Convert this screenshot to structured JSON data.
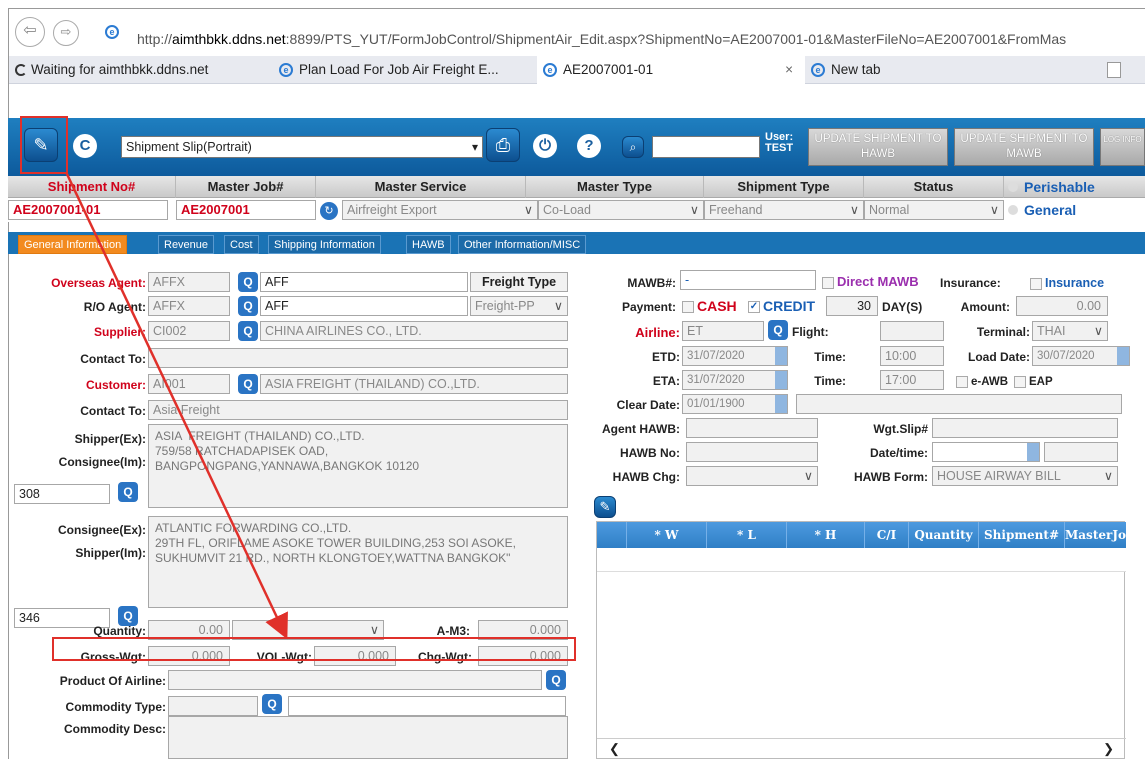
{
  "browser": {
    "url_prefix": "http://",
    "url_host": "aimthbkk.ddns.net",
    "url_rest": ":8899/PTS_YUT/FormJobControl/ShipmentAir_Edit.aspx?ShipmentNo=AE2007001-01&MasterFileNo=AE2007001&FromMas",
    "tabs": [
      {
        "label": "Waiting for aimthbkk.ddns.net"
      },
      {
        "label": "Plan Load For Job Air Freight E..."
      },
      {
        "label": "AE2007001-01"
      },
      {
        "label": "New tab"
      }
    ]
  },
  "toolbar": {
    "report_select": "Shipment Slip(Portrait)",
    "user_label": "User:",
    "user_name": "TEST",
    "update_hawb": "UPDATE SHIPMENT TO HAWB",
    "update_mawb": "UPDATE SHIPMENT TO MAWB",
    "logout": "LOG INFO"
  },
  "header": {
    "columns": [
      "Shipment No#",
      "Master Job#",
      "Master Service",
      "Master Type",
      "Shipment Type",
      "Status"
    ],
    "perishable": "Perishable",
    "general": "General",
    "shipment_no": "AE2007001-01",
    "master_job": "AE2007001",
    "master_service": "Airfreight Export",
    "master_type": "Co-Load",
    "shipment_type": "Freehand",
    "status": "Normal"
  },
  "page_tabs": [
    "General Information",
    "Revenue",
    "Cost",
    "Shipping Information",
    "HAWB",
    "Other Information/MISC"
  ],
  "left": {
    "overseas_agent_label": "Overseas Agent:",
    "overseas_agent_code": "AFFX",
    "overseas_agent_name": "AFF",
    "freight_type_label": "Freight Type",
    "ro_agent_label": "R/O Agent:",
    "ro_agent_code": "AFFX",
    "ro_agent_name": "AFF",
    "freight_type": "Freight-PP",
    "supplier_label": "Supplier:",
    "supplier_code": "CI002",
    "supplier_name": "CHINA AIRLINES CO., LTD.",
    "contact_to_label": "Contact To:",
    "contact_to_1": "",
    "customer_label": "Customer:",
    "customer_code": "AI001",
    "customer_name": "ASIA  FREIGHT (THAILAND) CO.,LTD.",
    "contact_to_2": "Asia Freight",
    "shipper_ex_label": "Shipper(Ex):",
    "consignee_im_label": "Consignee(Im):",
    "shipper_text": "ASIA  FREIGHT (THAILAND) CO.,LTD.\n759/58 RATCHADAPISEK OAD,\nBANGPONGPANG,YANNAWA,BANGKOK 10120",
    "shipper_no": "308",
    "consignee_ex_label": "Consignee(Ex):",
    "shipper_im_label": "Shipper(Im):",
    "consignee_text": "ATLANTIC FORWARDING CO.,LTD.\n29TH FL, ORIFLAME ASOKE TOWER BUILDING,253 SOI ASOKE,\nSUKHUMVIT 21 RD., NORTH KLONGTOEY,WATTNA BANGKOK\"",
    "consignee_no": "346",
    "quantity_label": "Quantity:",
    "quantity": "0.00",
    "am3_label": "A-M3:",
    "am3": "0.000",
    "gross_label": "Gross-Wgt:",
    "gross": "0.000",
    "vol_label": "VOL-Wgt:",
    "vol": "0.000",
    "chg_label": "Chg-Wgt:",
    "chg": "0.000",
    "product_label": "Product Of Airline:",
    "commodity_type_label": "Commodity Type:",
    "commodity_desc_label": "Commodity Desc:"
  },
  "right": {
    "mawb_label": "MAWB#:",
    "mawb": "-",
    "direct_mawb": "Direct MAWB",
    "insurance_label": "Insurance:",
    "insurance": "Insurance",
    "payment_label": "Payment:",
    "cash": "CASH",
    "credit": "CREDIT",
    "days": "30",
    "days_label": "DAY(S)",
    "amount_label": "Amount:",
    "amount": "0.00",
    "airline_label": "Airline:",
    "airline": "ET",
    "flight_label": "Flight:",
    "terminal_label": "Terminal:",
    "terminal": "THAI",
    "etd_label": "ETD:",
    "etd": "31/07/2020",
    "time_label": "Time:",
    "etd_time": "10:00",
    "load_date_label": "Load Date:",
    "load_date": "30/07/2020",
    "eta_label": "ETA:",
    "eta": "31/07/2020",
    "eta_time": "17:00",
    "eawb": "e-AWB",
    "eap": "EAP",
    "clear_date_label": "Clear Date:",
    "clear_date": "01/01/1900",
    "agent_hawb_label": "Agent HAWB:",
    "wgt_slip_label": "Wgt.Slip#",
    "hawb_no_label": "HAWB No:",
    "datetime_label": "Date/time:",
    "hawb_chg_label": "HAWB Chg:",
    "hawb_form_label": "HAWB Form:",
    "hawb_form": "HOUSE AIRWAY BILL",
    "grid_headers": [
      "* W",
      "* L",
      "* H",
      "C/I",
      "Quantity",
      "Shipment#",
      "MasterJob#"
    ]
  }
}
